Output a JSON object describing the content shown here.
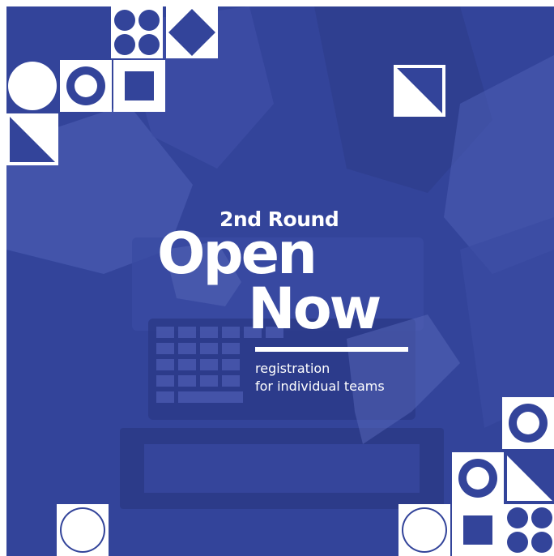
{
  "headline": {
    "eyebrow": "2nd Round",
    "line1": "Open",
    "line2": "Now",
    "subline1": "registration",
    "subline2": "for individual teams"
  },
  "colors": {
    "background": "#33449a",
    "shapes": "#ffffff"
  },
  "icons": [
    "circle-tile",
    "ring-tile",
    "square-tile",
    "diamond-tile",
    "four-circles-tile",
    "triangle-tile"
  ]
}
